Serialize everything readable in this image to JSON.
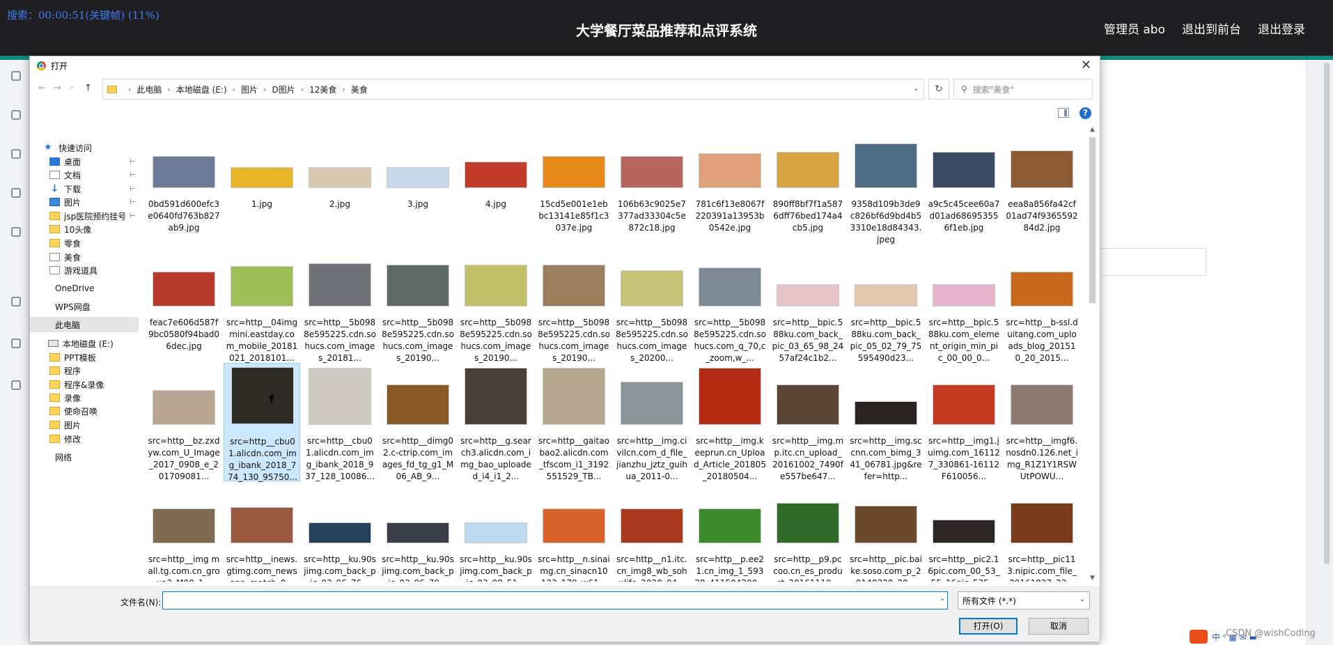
{
  "recording": "搜索：00:00:51(关键帧) (11%)",
  "app": {
    "title": "大学餐厅菜品推荐和点评系统",
    "admin_label": "管理员 abo",
    "to_front_label": "退出到前台",
    "logout_label": "退出登录"
  },
  "dialog": {
    "title": "打开",
    "close_glyph": "✕",
    "nav": {
      "back": "←",
      "forward": "→",
      "recent": "⌄",
      "up": "↑"
    },
    "breadcrumb": [
      "此电脑",
      "本地磁盘 (E:)",
      "图片",
      "D图片",
      "12美食",
      "美食"
    ],
    "breadcrumb_sep": "›",
    "refresh_glyph": "↻",
    "search_placeholder": "搜索\"美食\"",
    "help_glyph": "?"
  },
  "sidebar": {
    "items": [
      {
        "label": "快速访问",
        "icon": "star-icon",
        "pinned": false
      },
      {
        "label": "桌面",
        "icon": "desktop-icon",
        "pinned": true
      },
      {
        "label": "文档",
        "icon": "document-icon",
        "pinned": true
      },
      {
        "label": "下载",
        "icon": "download-icon",
        "pinned": true
      },
      {
        "label": "图片",
        "icon": "pictures-icon",
        "pinned": true
      },
      {
        "label": "jsp医院预约挂号",
        "icon": "folder-icon",
        "pinned": true
      },
      {
        "label": "10头像",
        "icon": "folder-icon",
        "pinned": false
      },
      {
        "label": "零食",
        "icon": "folder-icon",
        "pinned": false
      },
      {
        "label": "美食",
        "icon": "document-icon",
        "pinned": false
      },
      {
        "label": "游戏道具",
        "icon": "document-icon",
        "pinned": false
      },
      {
        "label": "OneDrive",
        "icon": "",
        "pinned": false
      },
      {
        "label": "WPS网盘",
        "icon": "",
        "pinned": false
      },
      {
        "label": "此电脑",
        "icon": "",
        "pinned": false,
        "selected": true
      },
      {
        "label": "本地磁盘 (E:)",
        "icon": "drive-icon",
        "pinned": false
      },
      {
        "label": "PPT模板",
        "icon": "folder-icon",
        "pinned": false
      },
      {
        "label": "程序",
        "icon": "folder-icon",
        "pinned": false
      },
      {
        "label": "程序&录像",
        "icon": "folder-icon",
        "pinned": false
      },
      {
        "label": "录像",
        "icon": "folder-icon",
        "pinned": false
      },
      {
        "label": "使命召唤",
        "icon": "folder-icon",
        "pinned": false
      },
      {
        "label": "图片",
        "icon": "folder-icon",
        "pinned": false
      },
      {
        "label": "修改",
        "icon": "folder-icon",
        "pinned": false
      },
      {
        "label": "网络",
        "icon": "",
        "pinned": false
      }
    ]
  },
  "files": [
    {
      "name": "0bd591d600efc3e0640fd763b827ab9.jpg",
      "color": "#6d7a9a"
    },
    {
      "name": "1.jpg",
      "color": "#e8b428"
    },
    {
      "name": "2.jpg",
      "color": "#d9c7b2"
    },
    {
      "name": "3.jpg",
      "color": "#c9d9ec"
    },
    {
      "name": "4.jpg",
      "color": "#c23a2a"
    },
    {
      "name": "15cd5e001e1ebbc13141e85f1c3037e.jpg",
      "color": "#e88a1a"
    },
    {
      "name": "106b63c9025e7377ad33304c5e872c18.jpg",
      "color": "#b7665e"
    },
    {
      "name": "781c6f13e8067f220391a13953b0542e.jpg",
      "color": "#e0a079"
    },
    {
      "name": "890ff8bf7f1a5876dff76bed174a4cb5.jpg",
      "color": "#d9a542"
    },
    {
      "name": "9358d109b3de9c826bf6d9bd4b53310e18d84343.jpeg",
      "color": "#4f6c87"
    },
    {
      "name": "a9c5c45cee60a7d01ad686953556f1eb.jpg",
      "color": "#3a4a63"
    },
    {
      "name": "eea8a856fa42cf01ad74f936559284d2.jpg",
      "color": "#8d5a36"
    },
    {
      "name": "feac7e606d587f9bc0580f94bad06dec.jpg",
      "color": "#b83a2c"
    },
    {
      "name": "src=http__04imgmini.eastday.com_mobile_20181021_2018101...",
      "color": "#9fbf5a"
    },
    {
      "name": "src=http__5b0988e595225.cdn.sohucs.com_images_20181...",
      "color": "#6e7277"
    },
    {
      "name": "src=http__5b0988e595225.cdn.sohucs.com_images_20190...",
      "color": "#5d6a66"
    },
    {
      "name": "src=http__5b0988e595225.cdn.sohucs.com_images_20190...",
      "color": "#c3c06b"
    },
    {
      "name": "src=http__5b0988e595225.cdn.sohucs.com_images_20190...",
      "color": "#9c7d5e"
    },
    {
      "name": "src=http__5b0988e595225.cdn.sohucs.com_images_20200...",
      "color": "#c7c379"
    },
    {
      "name": "src=http__5b0988e595225.cdn.sohucs.com_q_70,c_zoom,w_...",
      "color": "#7d8a95"
    },
    {
      "name": "src=http__bpic.588ku.com_back_pic_03_65_98_2457af24c1b2...",
      "color": "#e7c4c7"
    },
    {
      "name": "src=http__bpic.588ku.com_back_pic_05_02_79_75595490d23...",
      "color": "#e3c9ad"
    },
    {
      "name": "src=http__bpic.588ku.com_element_origin_min_pic_00_00_0...",
      "color": "#e6b3cb"
    },
    {
      "name": "src=http__b-ssl.duitang.com_uploads_blog_201510_20_2015...",
      "color": "#c76a1e"
    },
    {
      "name": "src=http__bz.zxdyw.com_U_Image_2017_0908_e_201709081...",
      "color": "#b8a592"
    },
    {
      "name": "src=http__cbu01.alicdn.com_img_ibank_2018_774_130_95750...",
      "color": "#2e2a26",
      "selected": true
    },
    {
      "name": "src=http__cbu01.alicdn.com_img_ibank_2018_937_128_10086...",
      "color": "#cfcac1"
    },
    {
      "name": "src=http__dimg02.c-ctrip.com_images_fd_tg_g1_M06_AB_9...",
      "color": "#8a5a26"
    },
    {
      "name": "src=http__g.search3.alicdn.com_img_bao_uploaded_i4_i1_2...",
      "color": "#4a4038"
    },
    {
      "name": "src=http__gaitaobao2.alicdn.com_tfscom_i1_3192551529_TB...",
      "color": "#b6a791"
    },
    {
      "name": "src=http__img.civilcn.com_d_file_jianzhu_jztz_guihua_2011-0...",
      "color": "#8a9499"
    },
    {
      "name": "src=http__img.keeprun.cn_Upload_Article_201805_20180504...",
      "color": "#b42b14"
    },
    {
      "name": "src=http__img.mp.itc.cn_upload_20161002_7490fe557be647...",
      "color": "#5b4636"
    },
    {
      "name": "src=http__img.sccnn.com_bimg_341_06781.jpg&refer=http...",
      "color": "#2b2422"
    },
    {
      "name": "src=http__img1.juimg.com_161127_330861-16112F610056...",
      "color": "#c63a22"
    },
    {
      "name": "src=http__imgf6.nosdn0.126.net_img_R1Z1Y1RSWUtPOWU...",
      "color": "#8c7a72"
    },
    {
      "name": "src=http__img mall.tg.com.cn_group2_M00_1...",
      "color": "#7f6a52"
    },
    {
      "name": "src=http__inews.gtimg.com_newsapp_match_0...",
      "color": "#9a5a42"
    },
    {
      "name": "src=http__ku.90sjimg.com_back_pic_03_96_76...",
      "color": "#27405c"
    },
    {
      "name": "src=http__ku.90sjimg.com_back_pic_03_96_79...",
      "color": "#3b3f4a"
    },
    {
      "name": "src=http__ku.90sjimg.com_back_pic_03_98_51...",
      "color": "#bfdaf0"
    },
    {
      "name": "src=http__n.sinaimg.cn_sinacn10123_179_w61...",
      "color": "#d8622a"
    },
    {
      "name": "src=http__n1.itc.cn_img8_wb_sohulife_2020_04...",
      "color": "#a8381e"
    },
    {
      "name": "src=http__p.ee21.cn_img_1_59328_411504200...",
      "color": "#3c8a2c"
    },
    {
      "name": "src=http__p9.pccoo.cn_es_product_20161119...",
      "color": "#2f6a2a"
    },
    {
      "name": "src=http__pic.baike.soso.com_p_20140320_20...",
      "color": "#6b4a2c"
    },
    {
      "name": "src=http__pic2.16pic.com_00_53_55_16pic_535...",
      "color": "#2b2624"
    },
    {
      "name": "src=http__pic113.nipic.com_file_20161027_23...",
      "color": "#7a3a1c"
    }
  ],
  "bottom": {
    "filename_label": "文件名(N):",
    "filename_value": "",
    "filetype_value": "所有文件 (*.*)",
    "open_label": "打开(O)",
    "cancel_label": "取消"
  },
  "watermark": "CSDN @wishCoding",
  "taskbar_icons": "中 ⁰ ▦ ✉ ▬"
}
